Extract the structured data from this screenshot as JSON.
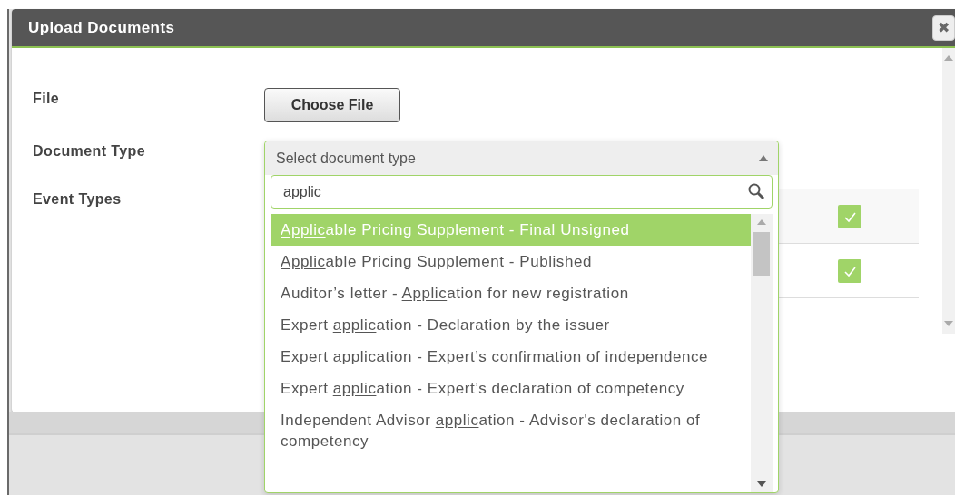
{
  "dialog": {
    "title": "Upload Documents",
    "close": "✖"
  },
  "form": {
    "file_label": "File",
    "file_button": "Choose File",
    "document_type_label": "Document Type",
    "event_types_label": "Event Types"
  },
  "document_type": {
    "placeholder": "Select document type",
    "expanded": true,
    "search": "applic",
    "options": [
      {
        "match": "Applic",
        "after": "able Pricing Supplement - Final Unsigned",
        "selected": true
      },
      {
        "match": "Applic",
        "after": "able Pricing Supplement - Published",
        "selected": false
      },
      {
        "before": "Auditor’s letter - ",
        "match": "Applic",
        "after": "ation for new registration",
        "selected": false
      },
      {
        "before": "Expert ",
        "match": "applic",
        "after": "ation - Declaration by the issuer",
        "selected": false
      },
      {
        "before": "Expert ",
        "match": "applic",
        "after": "ation - Expert’s confirmation of independence",
        "selected": false
      },
      {
        "before": "Expert ",
        "match": "applic",
        "after": "ation - Expert’s declaration of competency",
        "selected": false
      },
      {
        "before": "Independent Advisor ",
        "match": "applic",
        "after": "ation - Advisor's declaration of competency",
        "selected": false
      }
    ]
  },
  "event_types": [
    {
      "checked": true
    },
    {
      "checked": true
    }
  ]
}
